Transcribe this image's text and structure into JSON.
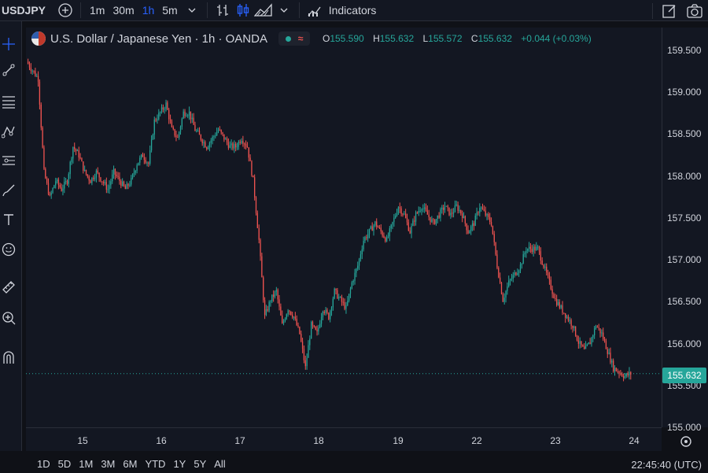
{
  "toolbar": {
    "symbol": "USDJPY",
    "intervals": [
      "1m",
      "30m",
      "1h",
      "5m"
    ],
    "active_interval": "1h",
    "indicators_label": "Indicators"
  },
  "legend": {
    "title": "U.S. Dollar / Japanese Yen · 1h · OANDA",
    "open_label": "O",
    "open": "155.590",
    "high_label": "H",
    "high": "155.632",
    "low_label": "L",
    "low": "155.572",
    "close_label": "C",
    "close": "155.632",
    "change": "+0.044 (+0.03%)"
  },
  "price_axis": {
    "ticks": [
      "159.500",
      "159.000",
      "158.500",
      "158.000",
      "157.500",
      "157.000",
      "156.500",
      "156.000",
      "155.500",
      "155.000"
    ],
    "last_price": "155.632"
  },
  "time_axis": {
    "ticks": [
      "15",
      "16",
      "17",
      "18",
      "19",
      "22",
      "23",
      "24"
    ]
  },
  "bottom": {
    "ranges": [
      "1D",
      "5D",
      "1M",
      "3M",
      "6M",
      "YTD",
      "1Y",
      "5Y",
      "All"
    ],
    "clock": "22:45:40 (UTC)"
  },
  "colors": {
    "up": "#26a69a",
    "down": "#ef5350",
    "background": "#131722",
    "active": "#2962ff"
  },
  "chart_data": {
    "type": "candlestick",
    "ylim": [
      155.0,
      159.7
    ],
    "x_labels": [
      "15",
      "16",
      "17",
      "18",
      "19",
      "22",
      "23",
      "24"
    ],
    "close_path": [
      159.3,
      159.2,
      159.1,
      158.0,
      157.7,
      157.9,
      157.8,
      157.9,
      158.3,
      158.2,
      158.0,
      157.9,
      158.0,
      157.9,
      157.8,
      158.0,
      157.9,
      157.8,
      157.9,
      158.1,
      158.2,
      158.1,
      158.6,
      158.7,
      158.8,
      158.5,
      158.4,
      158.7,
      158.7,
      158.5,
      158.4,
      158.3,
      158.4,
      158.5,
      158.4,
      158.3,
      158.3,
      158.4,
      158.3,
      157.9,
      157.2,
      156.3,
      156.5,
      156.6,
      156.2,
      156.4,
      156.3,
      156.1,
      155.7,
      156.2,
      156.1,
      156.4,
      156.3,
      156.6,
      156.5,
      156.4,
      156.7,
      156.9,
      157.2,
      157.3,
      157.4,
      157.3,
      157.2,
      157.4,
      157.6,
      157.5,
      157.3,
      157.5,
      157.6,
      157.5,
      157.4,
      157.5,
      157.6,
      157.5,
      157.6,
      157.5,
      157.3,
      157.4,
      157.6,
      157.5,
      157.4,
      156.9,
      156.5,
      156.7,
      156.8,
      156.9,
      157.1,
      157.1,
      157.1,
      156.9,
      156.7,
      156.5,
      156.4,
      156.3,
      156.2,
      156.0,
      155.9,
      156.0,
      156.2,
      156.1,
      155.9,
      155.7,
      155.65,
      155.6,
      155.632
    ]
  }
}
